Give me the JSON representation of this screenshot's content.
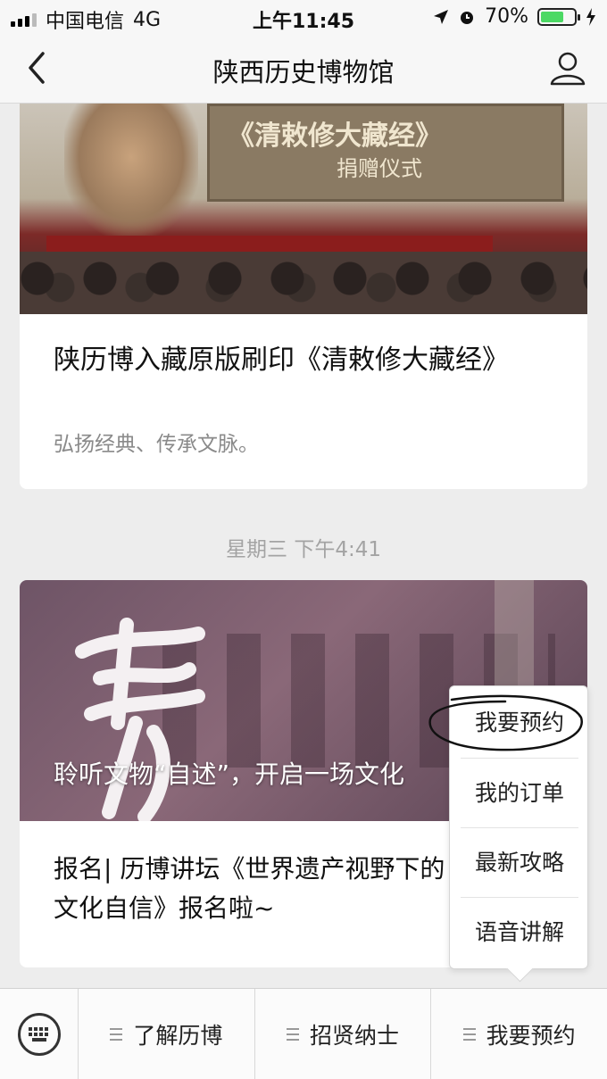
{
  "status_bar": {
    "carrier": "中国电信",
    "network": "4G",
    "time": "上午11:45",
    "battery": "70%",
    "battery_level": 0.7
  },
  "nav": {
    "title": "陕西历史博物馆",
    "back_icon": "chevron-left-icon",
    "profile_icon": "user-icon"
  },
  "articles": [
    {
      "banner_title": "《清敕修大藏经》",
      "banner_sub": "捐赠仪式",
      "title": "陕历博入藏原版刷印《清敕修大藏经》",
      "summary": "弘扬经典、传承文脉。"
    },
    {
      "overlay": "聆听文物“自述”，开启一场文化",
      "title": "报名| 历博讲坛《世界遗产视野下的文化自信》报名啦~"
    }
  ],
  "timestamp": "星期三 下午4:41",
  "popup_menu": {
    "items": [
      "我要预约",
      "我的订单",
      "最新攻略",
      "语音讲解"
    ]
  },
  "bottom_menu": {
    "keyboard_icon": "keyboard-icon",
    "items": [
      "了解历博",
      "招贤纳士",
      "我要预约"
    ]
  }
}
